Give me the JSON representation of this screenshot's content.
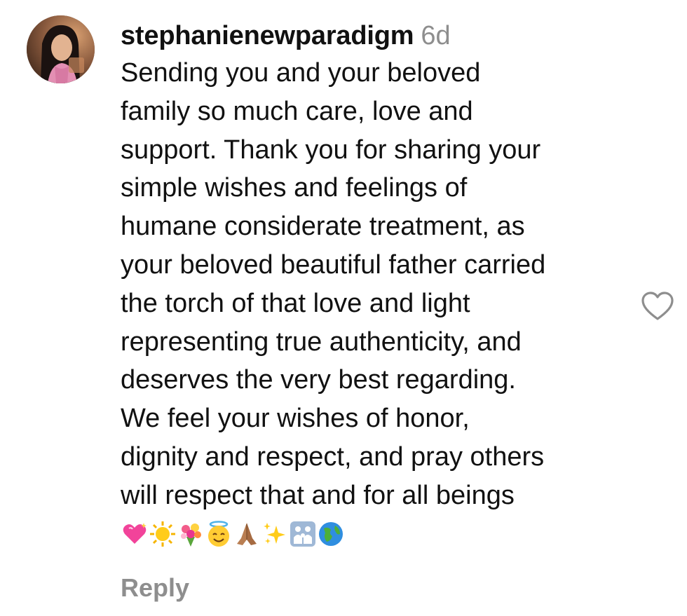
{
  "comment": {
    "username": "stephanienewparadigm",
    "timestamp": "6d",
    "text_lines": [
      "Sending you and your beloved",
      "family so much care, love and",
      "support. Thank you for sharing your",
      "simple wishes and feelings of",
      "humane considerate treatment, as",
      "your beloved beautiful father carried",
      "the torch of that love and light",
      "representing true authenticity, and",
      "deserves the very best regarding.",
      "We feel your wishes of honor,",
      "dignity and respect, and pray others",
      "will respect that and for all beings"
    ],
    "emojis": [
      "sparkling-heart",
      "sun",
      "bouquet",
      "smiling-face-with-halo",
      "folded-hands",
      "sparkles",
      "family",
      "globe"
    ],
    "reply_label": "Reply",
    "like_icon": "heart-outline-icon"
  },
  "colors": {
    "text": "#111111",
    "muted": "#8e8e8e",
    "background": "#ffffff"
  }
}
